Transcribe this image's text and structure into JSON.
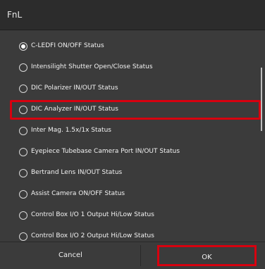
{
  "dialog": {
    "title": "FnL"
  },
  "options": [
    {
      "label": "C-LEDFI ON/OFF Status",
      "selected": true
    },
    {
      "label": "Intensilight Shutter Open/Close Status",
      "selected": false
    },
    {
      "label": "DIC Polarizer IN/OUT Status",
      "selected": false
    },
    {
      "label": "DIC Analyzer IN/OUT Status",
      "selected": false
    },
    {
      "label": "Inter Mag. 1.5x/1x Status",
      "selected": false
    },
    {
      "label": "Eyepiece Tubebase Camera Port IN/OUT Status",
      "selected": false
    },
    {
      "label": "Bertrand Lens IN/OUT Status",
      "selected": false
    },
    {
      "label": "Assist Camera ON/OFF Status",
      "selected": false
    },
    {
      "label": "Control Box I/O 1 Output Hi/Low Status",
      "selected": false
    },
    {
      "label": "Control Box I/O 2 Output Hi/Low Status",
      "selected": false
    }
  ],
  "buttons": {
    "cancel": "Cancel",
    "ok": "OK"
  },
  "colors": {
    "highlight": "#d7000f",
    "background": "#3b3b3b",
    "titlebar": "#2c2c2c"
  }
}
